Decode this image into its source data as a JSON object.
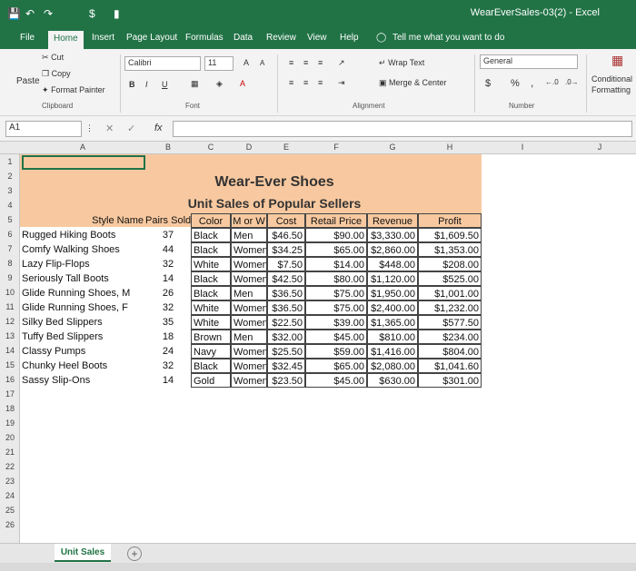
{
  "window": {
    "title": "WearEverSales-03(2) - Excel"
  },
  "ribbon_tabs": [
    "File",
    "Home",
    "Insert",
    "Page Layout",
    "Formulas",
    "Data",
    "Review",
    "View",
    "Help"
  ],
  "tell_me": "Tell me what you want to do",
  "clipboard": {
    "cut": "Cut",
    "copy": "Copy",
    "paste": "Paste",
    "format_painter": "Format Painter",
    "group": "Clipboard"
  },
  "font": {
    "name": "Calibri",
    "size": "11",
    "bold": "B",
    "italic": "I",
    "underline": "U",
    "group": "Font",
    "grow": "A",
    "shrink": "A"
  },
  "alignment": {
    "wrap": "Wrap Text",
    "merge": "Merge & Center",
    "group": "Alignment"
  },
  "number": {
    "format": "General",
    "currency": "$",
    "percent": "%",
    "comma": ",",
    "group": "Number"
  },
  "styles": {
    "conditional": "Conditional",
    "formatting": "Formatting"
  },
  "formula_bar": {
    "name_box": "A1",
    "fx": "fx",
    "value": ""
  },
  "columns": [
    "A",
    "B",
    "C",
    "D",
    "E",
    "F",
    "G",
    "H",
    "I",
    "J"
  ],
  "rows": [
    "1",
    "2",
    "3",
    "4",
    "5",
    "6",
    "7",
    "8",
    "9",
    "10",
    "11",
    "12",
    "13",
    "14",
    "15",
    "16",
    "17",
    "18",
    "19",
    "20",
    "21",
    "22",
    "23",
    "24",
    "25",
    "26"
  ],
  "sheet": {
    "title": "Wear-Ever Shoes",
    "subtitle": "Unit Sales of Popular Sellers",
    "headers": [
      "Style Name",
      "Pairs Sold",
      "Color",
      "M or W",
      "Cost",
      "Retail Price",
      "Revenue",
      "Profit"
    ],
    "data": [
      [
        "Rugged Hiking Boots",
        "37",
        "Black",
        "Men",
        "$46.50",
        "$90.00",
        "$3,330.00",
        "$1,609.50"
      ],
      [
        "Comfy Walking Shoes",
        "44",
        "Black",
        "Women",
        "$34.25",
        "$65.00",
        "$2,860.00",
        "$1,353.00"
      ],
      [
        "Lazy Flip-Flops",
        "32",
        "White",
        "Women",
        "$7.50",
        "$14.00",
        "$448.00",
        "$208.00"
      ],
      [
        "Seriously Tall Boots",
        "14",
        "Black",
        "Women",
        "$42.50",
        "$80.00",
        "$1,120.00",
        "$525.00"
      ],
      [
        "Glide Running Shoes, M",
        "26",
        "Black",
        "Men",
        "$36.50",
        "$75.00",
        "$1,950.00",
        "$1,001.00"
      ],
      [
        "Glide Running Shoes, F",
        "32",
        "White",
        "Women",
        "$36.50",
        "$75.00",
        "$2,400.00",
        "$1,232.00"
      ],
      [
        "Silky Bed Slippers",
        "35",
        "White",
        "Women",
        "$22.50",
        "$39.00",
        "$1,365.00",
        "$577.50"
      ],
      [
        "Tuffy Bed Slippers",
        "18",
        "Brown",
        "Men",
        "$32.00",
        "$45.00",
        "$810.00",
        "$234.00"
      ],
      [
        "Classy Pumps",
        "24",
        "Navy",
        "Women",
        "$25.50",
        "$59.00",
        "$1,416.00",
        "$804.00"
      ],
      [
        "Chunky Heel Boots",
        "32",
        "Black",
        "Women",
        "$32.45",
        "$65.00",
        "$2,080.00",
        "$1,041.60"
      ],
      [
        "Sassy Slip-Ons",
        "14",
        "Gold",
        "Women",
        "$23.50",
        "$45.00",
        "$630.00",
        "$301.00"
      ]
    ]
  },
  "sheet_tab": "Unit Sales",
  "colors": {
    "excel_green": "#217346",
    "banner": "#f8c9a0"
  }
}
